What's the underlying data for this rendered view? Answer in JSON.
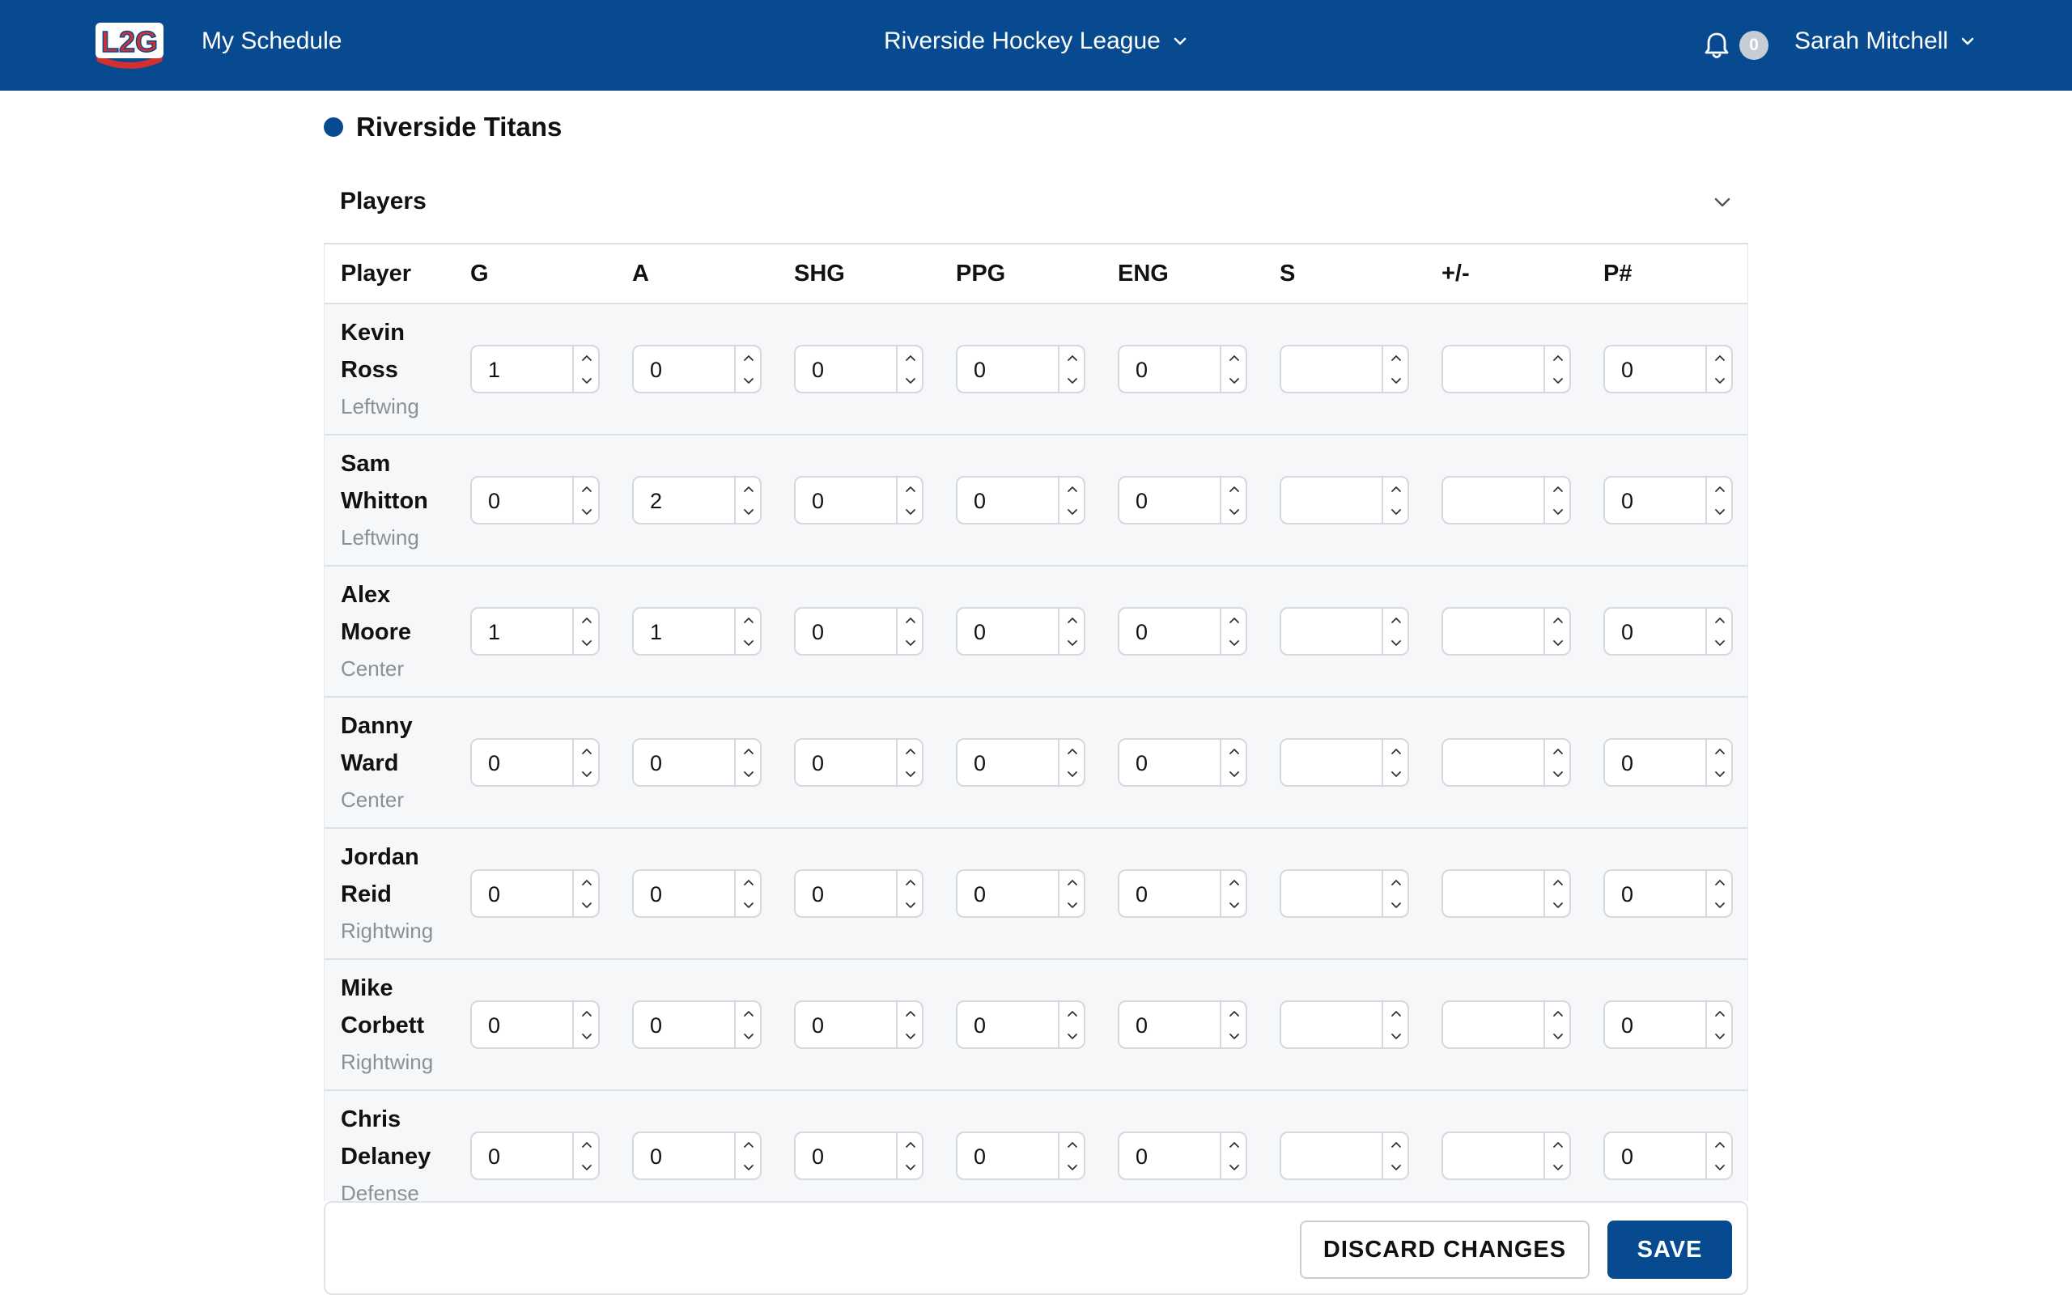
{
  "header": {
    "logo_text": "L2G",
    "nav_link": "My Schedule",
    "league": "Riverside Hockey League",
    "notifications_count": "0",
    "user_name": "Sarah Mitchell"
  },
  "team": {
    "name": "Riverside Titans",
    "color": "#074a8f"
  },
  "players_section": {
    "title": "Players",
    "columns": [
      "Player",
      "G",
      "A",
      "SHG",
      "PPG",
      "ENG",
      "S",
      "+/-",
      "P#"
    ],
    "rows": [
      {
        "first": "Kevin",
        "last": "Ross",
        "position": "Leftwing",
        "stats": [
          "1",
          "0",
          "0",
          "0",
          "0",
          "",
          "",
          "0"
        ]
      },
      {
        "first": "Sam",
        "last": "Whitton",
        "position": "Leftwing",
        "stats": [
          "0",
          "2",
          "0",
          "0",
          "0",
          "",
          "",
          "0"
        ]
      },
      {
        "first": "Alex",
        "last": "Moore",
        "position": "Center",
        "stats": [
          "1",
          "1",
          "0",
          "0",
          "0",
          "",
          "",
          "0"
        ]
      },
      {
        "first": "Danny",
        "last": "Ward",
        "position": "Center",
        "stats": [
          "0",
          "0",
          "0",
          "0",
          "0",
          "",
          "",
          "0"
        ]
      },
      {
        "first": "Jordan",
        "last": "Reid",
        "position": "Rightwing",
        "stats": [
          "0",
          "0",
          "0",
          "0",
          "0",
          "",
          "",
          "0"
        ]
      },
      {
        "first": "Mike",
        "last": "Corbett",
        "position": "Rightwing",
        "stats": [
          "0",
          "0",
          "0",
          "0",
          "0",
          "",
          "",
          "0"
        ]
      },
      {
        "first": "Chris",
        "last": "Delaney",
        "position": "Defense",
        "stats": [
          "0",
          "0",
          "0",
          "0",
          "0",
          "",
          "",
          "0"
        ]
      }
    ]
  },
  "footer": {
    "discard_label": "DISCARD CHANGES",
    "save_label": "SAVE"
  },
  "colors": {
    "primary": "#074a8f",
    "row_bg": "#f6f7f9",
    "muted_text": "#8a9099"
  }
}
